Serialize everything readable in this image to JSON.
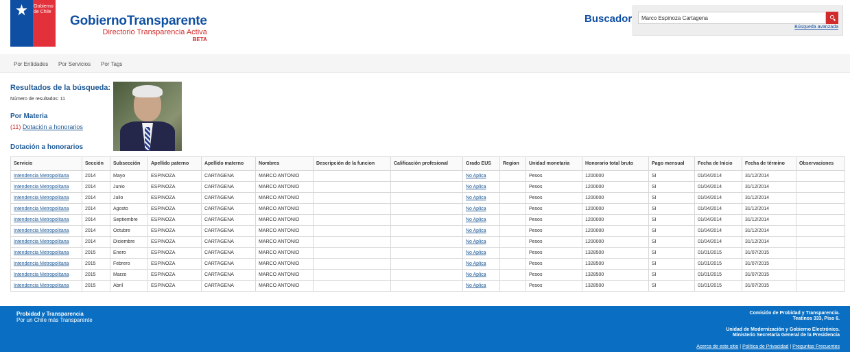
{
  "logo": {
    "text": "Gobierno de Chile"
  },
  "brand": {
    "name": "GobiernoTransparente",
    "subtitle": "Directorio Transparencia Activa",
    "beta": "BETA"
  },
  "search": {
    "label": "Buscador",
    "value": "Marco Espinoza Cartagena",
    "advanced": "Búsqueda avanzada"
  },
  "nav": {
    "items": [
      "Por Entidades",
      "Por Servicios",
      "Por Tags"
    ]
  },
  "results": {
    "title": "Resultados de la búsqueda:",
    "count": "Número de resultados: 11",
    "materia_title": "Por Materia",
    "materia_count": "(11)",
    "materia_link": "Dotación a honorarios",
    "section_title": "Dotación a honorarios"
  },
  "table": {
    "headers": [
      "Servicio",
      "Sección",
      "Subsección",
      "Apellido paterno",
      "Apellido materno",
      "Nombres",
      "Descripción de la funcion",
      "Calificación profesional",
      "Grado EUS",
      "Region",
      "Unidad monetaria",
      "Honorario total bruto",
      "Pago mensual",
      "Fecha de Inicio",
      "Fecha de término",
      "Observaciones"
    ],
    "rows": [
      [
        "Intendencia Metropolitana",
        "2014",
        "Mayo",
        "ESPINOZA",
        "CARTAGENA",
        "MARCO ANTONIO",
        "",
        "",
        "No Aplica",
        "",
        "Pesos",
        "1200000",
        "SI",
        "01/04/2014",
        "31/12/2014",
        ""
      ],
      [
        "Intendencia Metropolitana",
        "2014",
        "Junio",
        "ESPINOZA",
        "CARTAGENA",
        "MARCO ANTONIO",
        "",
        "",
        "No Aplica",
        "",
        "Pesos",
        "1200000",
        "SI",
        "01/04/2014",
        "31/12/2014",
        ""
      ],
      [
        "Intendencia Metropolitana",
        "2014",
        "Julio",
        "ESPINOZA",
        "CARTAGENA",
        "MARCO ANTONIO",
        "",
        "",
        "No Aplica",
        "",
        "Pesos",
        "1200000",
        "SI",
        "01/04/2014",
        "31/12/2014",
        ""
      ],
      [
        "Intendencia Metropolitana",
        "2014",
        "Agosto",
        "ESPINOZA",
        "CARTAGENA",
        "MARCO ANTONIO",
        "",
        "",
        "No Aplica",
        "",
        "Pesos",
        "1200000",
        "SI",
        "01/04/2014",
        "31/12/2014",
        ""
      ],
      [
        "Intendencia Metropolitana",
        "2014",
        "Septiembre",
        "ESPINOZA",
        "CARTAGENA",
        "MARCO ANTONIO",
        "",
        "",
        "No Aplica",
        "",
        "Pesos",
        "1200000",
        "SI",
        "01/04/2014",
        "31/12/2014",
        ""
      ],
      [
        "Intendencia Metropolitana",
        "2014",
        "Octubre",
        "ESPINOZA",
        "CARTAGENA",
        "MARCO ANTONIO",
        "",
        "",
        "No Aplica",
        "",
        "Pesos",
        "1200000",
        "SI",
        "01/04/2014",
        "31/12/2014",
        ""
      ],
      [
        "Intendencia Metropolitana",
        "2014",
        "Diciembre",
        "ESPINOZA",
        "CARTAGENA",
        "MARCO ANTONIO",
        "",
        "",
        "No Aplica",
        "",
        "Pesos",
        "1200000",
        "SI",
        "01/04/2014",
        "31/12/2014",
        ""
      ],
      [
        "Intendencia Metropolitana",
        "2015",
        "Enero",
        "ESPINOZA",
        "CARTAGENA",
        "MARCO ANTONIO",
        "",
        "",
        "No Aplica",
        "",
        "Pesos",
        "1328500",
        "SI",
        "01/01/2015",
        "31/07/2015",
        ""
      ],
      [
        "Intendencia Metropolitana",
        "2015",
        "Febrero",
        "ESPINOZA",
        "CARTAGENA",
        "MARCO ANTONIO",
        "",
        "",
        "No Aplica",
        "",
        "Pesos",
        "1328500",
        "SI",
        "01/01/2015",
        "31/07/2015",
        ""
      ],
      [
        "Intendencia Metropolitana",
        "2015",
        "Marzo",
        "ESPINOZA",
        "CARTAGENA",
        "MARCO ANTONIO",
        "",
        "",
        "No Aplica",
        "",
        "Pesos",
        "1328500",
        "SI",
        "01/01/2015",
        "31/07/2015",
        ""
      ],
      [
        "Intendencia Metropolitana",
        "2015",
        "Abril",
        "ESPINOZA",
        "CARTAGENA",
        "MARCO ANTONIO",
        "",
        "",
        "No Aplica",
        "",
        "Pesos",
        "1328500",
        "SI",
        "01/01/2015",
        "31/07/2015",
        ""
      ]
    ]
  },
  "footer": {
    "left_title": "Probidad y Transparencia",
    "left_sub": "Por un Chile más Transparente",
    "right_1": "Comisión de Probidad y Transparencia.",
    "right_2": "Teatinos 333, Piso 6.",
    "right_3": "Unidad de Modernización y Gobierno Electrónico.",
    "right_4": "Ministerio Secretaría General de la Presidencia",
    "links": [
      "Acerca de este sitio",
      "Política de Privacidad",
      "Preguntas Frecuentes"
    ],
    "separator": "|"
  },
  "colors": {
    "brand_blue": "#0f4fa3",
    "brand_red": "#d12b2b",
    "footer_blue": "#0a6fc2"
  }
}
